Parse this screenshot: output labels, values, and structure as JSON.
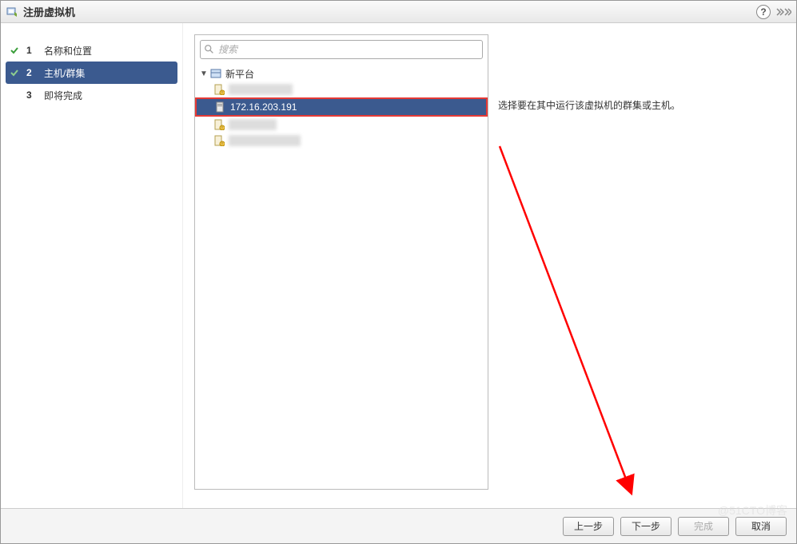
{
  "dialog": {
    "title": "注册虚拟机"
  },
  "steps": {
    "items": [
      {
        "num": "1",
        "label": "名称和位置",
        "completed": true
      },
      {
        "num": "2",
        "label": "主机/群集",
        "completed": true,
        "active": true
      },
      {
        "num": "3",
        "label": "即将完成",
        "completed": false
      }
    ]
  },
  "search": {
    "placeholder": "搜索"
  },
  "tree": {
    "root_label": "新平台",
    "items": [
      {
        "label": "",
        "redacted": true
      },
      {
        "label": "172.16.203.191",
        "selected": true,
        "highlighted": true
      },
      {
        "label": "",
        "redacted": true
      },
      {
        "label": "",
        "redacted": true
      }
    ]
  },
  "info": {
    "text": "选择要在其中运行该虚拟机的群集或主机。"
  },
  "buttons": {
    "back": "上一步",
    "next": "下一步",
    "finish": "完成",
    "cancel": "取消"
  },
  "watermark": "@51CTO博客"
}
